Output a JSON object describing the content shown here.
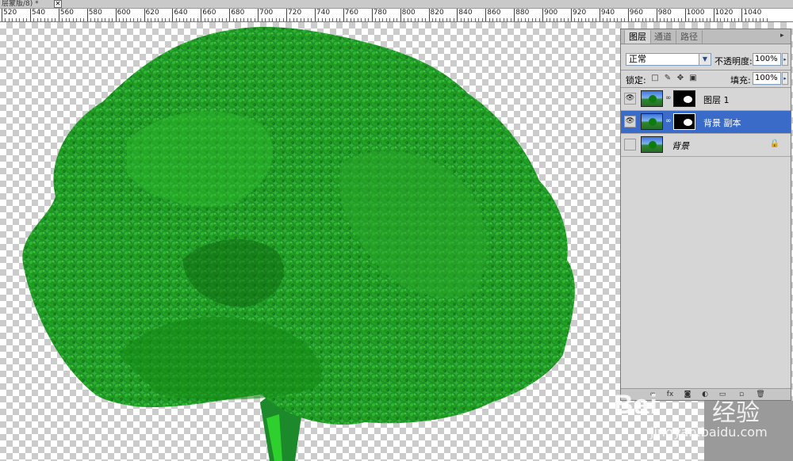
{
  "document": {
    "tab_title": "层蒙版/8) *",
    "close_glyph": "✕"
  },
  "ruler": {
    "labels": [
      "520",
      "540",
      "560",
      "580",
      "600",
      "620",
      "640",
      "660",
      "680",
      "700",
      "720",
      "740",
      "760",
      "780",
      "800",
      "820",
      "840",
      "860",
      "880",
      "900",
      "920",
      "940",
      "960",
      "980",
      "1000",
      "1020",
      "1040"
    ]
  },
  "layers_panel": {
    "tabs": [
      "图层",
      "通道",
      "路径"
    ],
    "menu_glyph": "▸",
    "blend_mode": "正常",
    "opacity_label": "不透明度:",
    "opacity_value": "100%",
    "lock_label": "锁定:",
    "fill_label": "填充:",
    "fill_value": "100%",
    "layers": [
      {
        "name": "图层 1",
        "visible": true,
        "selected": false,
        "has_mask": true,
        "locked": false
      },
      {
        "name": "背景 副本",
        "visible": true,
        "selected": true,
        "has_mask": true,
        "locked": false
      },
      {
        "name": "背景",
        "visible": false,
        "selected": false,
        "has_mask": false,
        "locked": true
      }
    ]
  },
  "watermark": {
    "brand": "Bai",
    "brand_cn": "经验",
    "site": "jingyan.baidu.com"
  },
  "colors": {
    "foliage": "#1f9a1f",
    "trunk": "#1c8a2a",
    "selected_layer": "#3a6bc9"
  }
}
